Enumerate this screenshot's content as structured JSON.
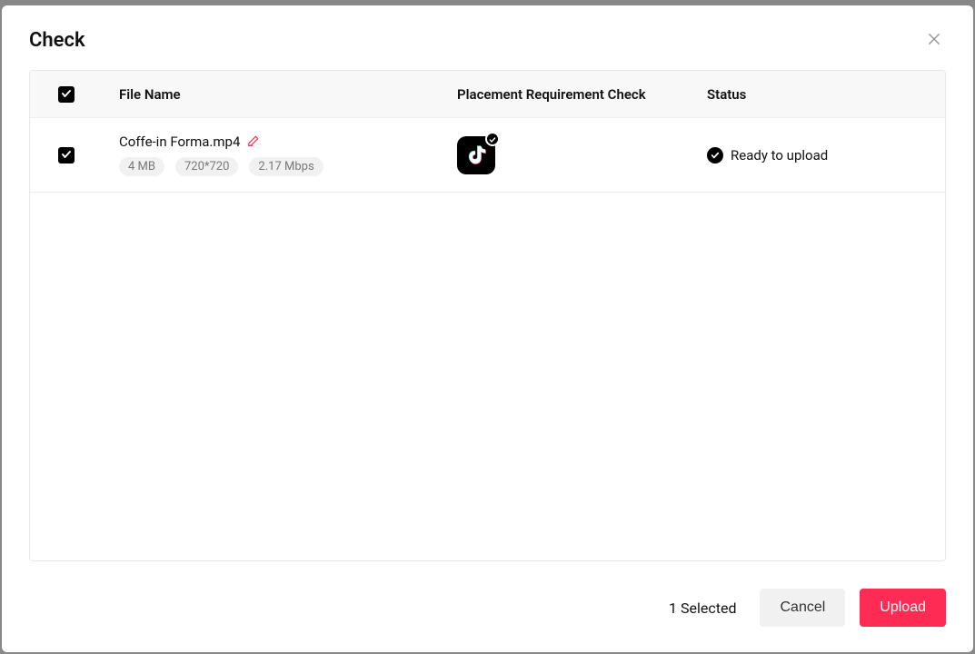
{
  "modal": {
    "title": "Check"
  },
  "table": {
    "headers": {
      "file_name": "File Name",
      "placement": "Placement Requirement Check",
      "status": "Status"
    },
    "rows": [
      {
        "file_name": "Coffe-in Forma.mp4",
        "size": "4 MB",
        "resolution": "720*720",
        "bitrate": "2.17 Mbps",
        "placement_icon": "tiktok",
        "placement_verified": true,
        "status_text": "Ready to upload",
        "checked": true
      }
    ]
  },
  "footer": {
    "selected_text": "1 Selected",
    "cancel_label": "Cancel",
    "upload_label": "Upload"
  },
  "colors": {
    "primary": "#fe2c55"
  }
}
